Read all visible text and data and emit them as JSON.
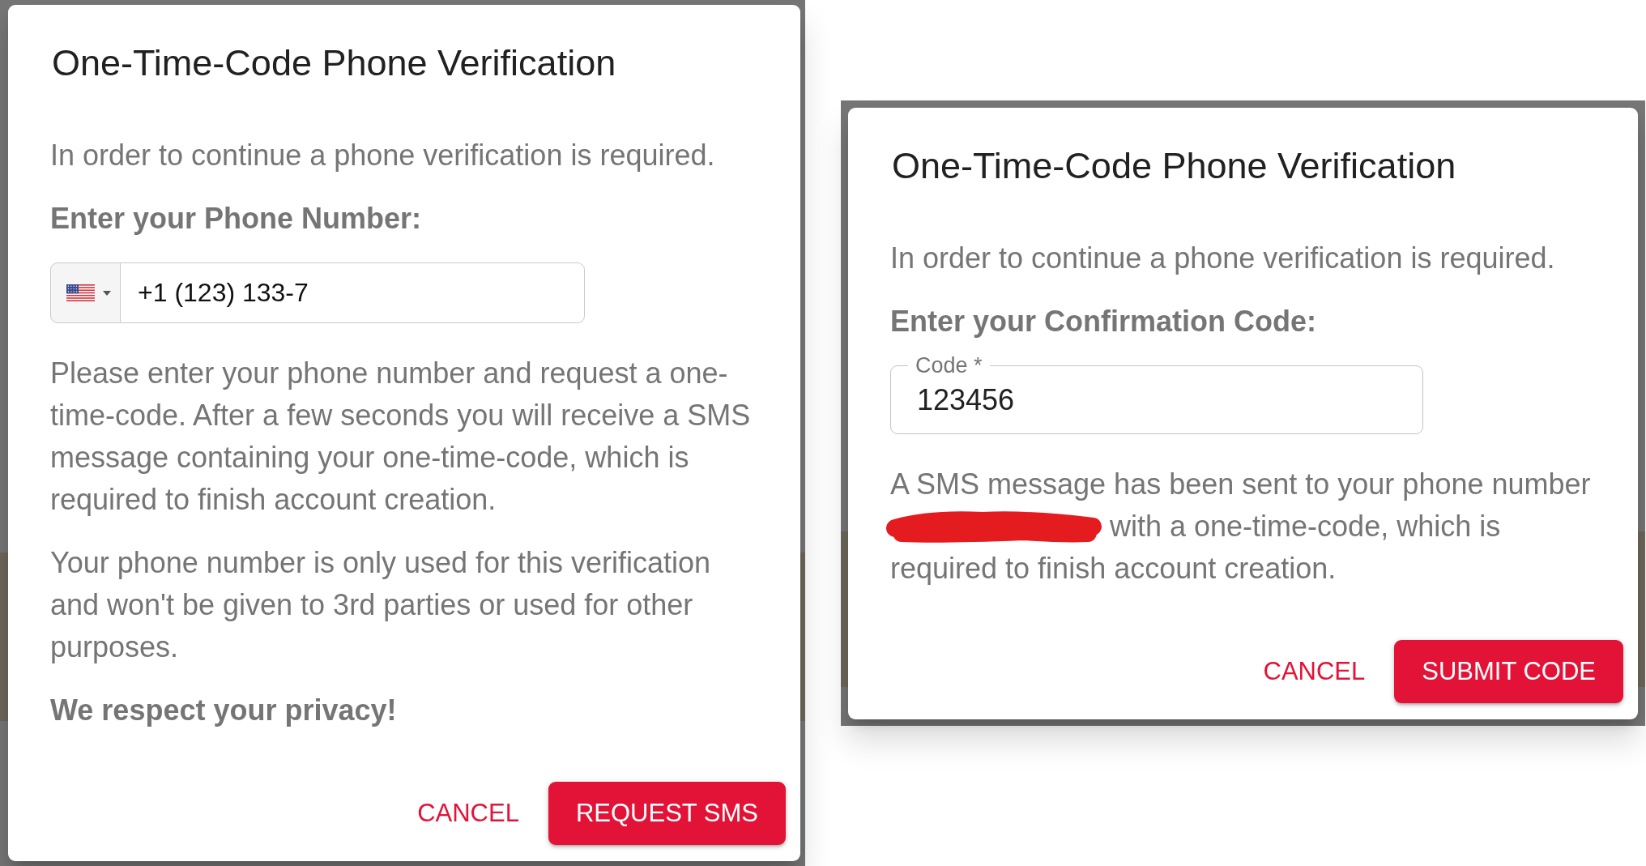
{
  "dialogs": [
    {
      "title": "One-Time-Code Phone Verification",
      "body": [
        {
          "kind": "paragraph",
          "text": "In order to continue a phone verification is required."
        },
        {
          "kind": "heading",
          "text": "Enter your Phone Number:"
        },
        {
          "kind": "phone_field",
          "value": "+1 (123) 133-7"
        },
        {
          "kind": "paragraph",
          "text": "Please enter your phone number and request a one-time-code. After a few seconds you will receive a SMS message containing your one-time-code, which is required to finish account creation."
        },
        {
          "kind": "paragraph",
          "text": "Your phone number is only used for this verification and won't be given to 3rd parties or used for other purposes."
        },
        {
          "kind": "heading",
          "text": "We respect your privacy!"
        }
      ],
      "actions": [
        {
          "kind": "text",
          "label": "CANCEL"
        },
        {
          "kind": "contained",
          "label": "REQUEST SMS"
        }
      ]
    },
    {
      "title": "One-Time-Code Phone Verification",
      "body": [
        {
          "kind": "paragraph",
          "text": "In order to continue a phone verification is required."
        },
        {
          "kind": "heading",
          "text": "Enter your Confirmation Code:"
        },
        {
          "kind": "code_field",
          "label": "Code *",
          "value": "123456"
        },
        {
          "kind": "redacted_message",
          "lines": [
            {
              "parts": [
                {
                  "kind": "text",
                  "text": "A SMS message has been sent to your phone number"
                }
              ]
            },
            {
              "parts": [
                {
                  "kind": "redaction"
                },
                {
                  "kind": "text",
                  "text": "with a one-time-code, which is"
                }
              ]
            },
            {
              "parts": [
                {
                  "kind": "text",
                  "text": "required to finish account creation."
                }
              ]
            }
          ]
        }
      ],
      "actions": [
        {
          "kind": "text",
          "label": "CANCEL"
        },
        {
          "kind": "contained",
          "label": "SUBMIT CODE"
        }
      ]
    }
  ]
}
